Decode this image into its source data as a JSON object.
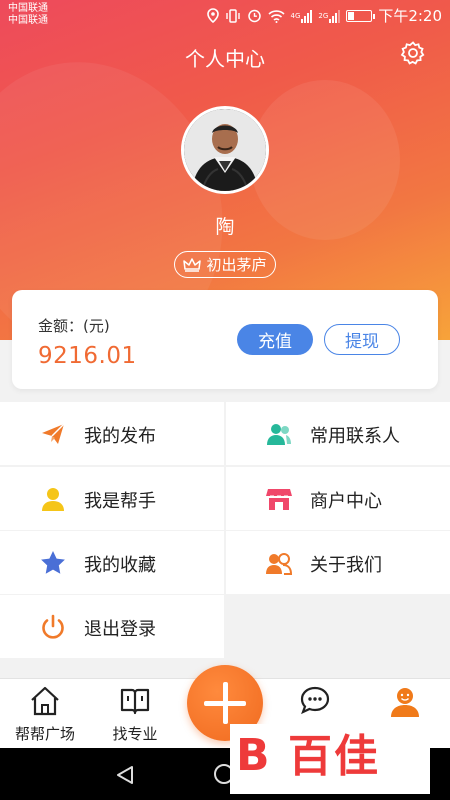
{
  "status_bar": {
    "carrier_1": "中国联通",
    "carrier_2": "中国联通",
    "net_1": "4G",
    "net_2": "2G",
    "time": "下午2:20"
  },
  "header": {
    "title": "个人中心",
    "settings_icon": "gear-icon",
    "username": "陶",
    "badge_label": "初出茅庐",
    "badge_icon": "crown-icon"
  },
  "balance": {
    "label": "金额：(元)",
    "value": "9216.01",
    "recharge_label": "充值",
    "withdraw_label": "提现"
  },
  "menu": [
    {
      "label": "我的发布",
      "icon": "paper-plane-icon",
      "color": "#f07a2a"
    },
    {
      "label": "常用联系人",
      "icon": "contacts-icon",
      "color": "#26b89a"
    },
    {
      "label": "我是帮手",
      "icon": "person-icon",
      "color": "#f5c518"
    },
    {
      "label": "商户中心",
      "icon": "shop-icon",
      "color": "#f0476a"
    },
    {
      "label": "我的收藏",
      "icon": "star-icon",
      "color": "#4a6fd6"
    },
    {
      "label": "关于我们",
      "icon": "group-icon",
      "color": "#f07a2a"
    },
    {
      "label": "退出登录",
      "icon": "power-icon",
      "color": "#f07a2a"
    }
  ],
  "tabbar": {
    "items": [
      {
        "label": "帮帮广场",
        "icon": "home-icon"
      },
      {
        "label": "找专业",
        "icon": "book-icon"
      },
      {
        "label": "",
        "icon": "chat-icon"
      },
      {
        "label": "",
        "icon": "profile-icon"
      }
    ],
    "fab_icon": "plus-icon"
  },
  "watermark": {
    "logo_mark": "B",
    "text": "百佳"
  },
  "colors": {
    "accent_orange": "#f06a33",
    "button_blue": "#4a85e6",
    "header_red": "#ee4a5c"
  }
}
